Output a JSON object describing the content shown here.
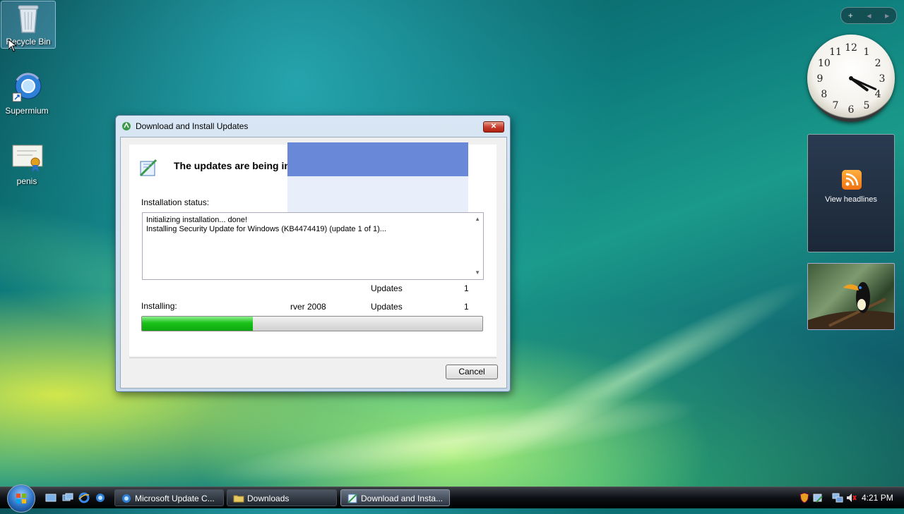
{
  "desktop": {
    "icons": [
      {
        "label": "Recycle Bin"
      },
      {
        "label": "Supermium"
      },
      {
        "label": "penis"
      }
    ]
  },
  "gadgets": {
    "control_add": "+",
    "control_prev": "◀",
    "control_next": "▶",
    "clock_numbers": [
      "12",
      "1",
      "2",
      "3",
      "4",
      "5",
      "6",
      "7",
      "8",
      "9",
      "10",
      "11"
    ],
    "headlines_label": "View headlines"
  },
  "dialog": {
    "title": "Download and Install Updates",
    "close": "✕",
    "heading": "The updates are being in",
    "installation_status_label": "Installation status:",
    "status_lines": [
      "Initializing installation... done!",
      "Installing Security Update for Windows (KB4474419) (update 1 of 1)..."
    ],
    "rows": [
      {
        "left": "",
        "category": "Updates",
        "count": "1"
      },
      {
        "left": "rver 2008",
        "category": "Updates",
        "count": "1"
      }
    ],
    "installing_label": "Installing:",
    "progress_fraction": 0.325,
    "cancel": "Cancel"
  },
  "taskbar": {
    "buttons": [
      {
        "label": "Microsoft Update C...",
        "icon": "browser-icon"
      },
      {
        "label": "Downloads",
        "icon": "folder-icon"
      },
      {
        "label": "Download and Insta...",
        "icon": "update-icon"
      }
    ],
    "time": "4:21 PM"
  },
  "colors": {
    "progress_green": "#1ac31a",
    "overlay_blue": "#6a88d8"
  }
}
